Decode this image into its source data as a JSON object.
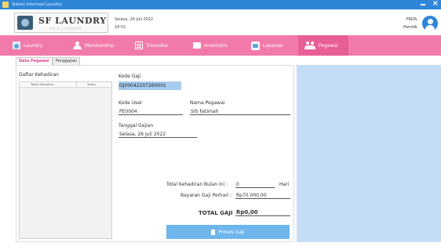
{
  "window": {
    "title": "Sistem Informasi Laundry"
  },
  "header": {
    "brand": "SF LAUNDRY",
    "tagline": "SAFA LAUNDRY",
    "date": "Selasa, 26 Juli 2022",
    "time": "18:51",
    "user_name": "FADIL",
    "user_role": "Pemilik"
  },
  "nav": [
    {
      "label": "Laundry",
      "icon": "washing-machine-icon"
    },
    {
      "label": "Membership",
      "icon": "user-icon"
    },
    {
      "label": "Transaksi",
      "icon": "receipt-icon"
    },
    {
      "label": "Inventaris",
      "icon": "box-icon"
    },
    {
      "label": "Layanan",
      "icon": "service-icon"
    },
    {
      "label": "Pegawai",
      "icon": "employees-icon"
    }
  ],
  "tabs": [
    {
      "label": "Data Pegawai"
    },
    {
      "label": "Penggajian"
    }
  ],
  "attendance": {
    "title": "Daftar Kehadiran",
    "columns": [
      "Waktu Kehadiran",
      "Status"
    ]
  },
  "form": {
    "kode_gaji_label": "Kode Gaji",
    "kode_gaji": "GJ00042207260001",
    "kode_user_label": "Kode User",
    "kode_user": "PE0004",
    "nama_pegawai_label": "Nama Pegawai",
    "nama_pegawai": "Siti Fatimah",
    "tanggal_gajian_label": "Tanggal Gajian",
    "tanggal_gajian": "Selasa, 26 Juli 2022",
    "total_kehadiran_label": "Total Kehadiran Bulan Ini :",
    "total_kehadiran": "0",
    "total_kehadiran_unit": "Hari",
    "bayaran_label": "Bayaran Gaji Perhari :",
    "bayaran": "Rp70.000,00",
    "total_gaji_label": "TOTAL GAJI",
    "total_gaji": "Rp0,00"
  },
  "actions": {
    "proses_label": "Proses Gaji"
  },
  "colors": {
    "titlebar": "#2f86d8",
    "nav": "#f27aab",
    "nav_active": "#e85e97",
    "accent_panel": "#c4dcf6",
    "button": "#6eb6ec",
    "highlight_field": "#a6cdee"
  }
}
